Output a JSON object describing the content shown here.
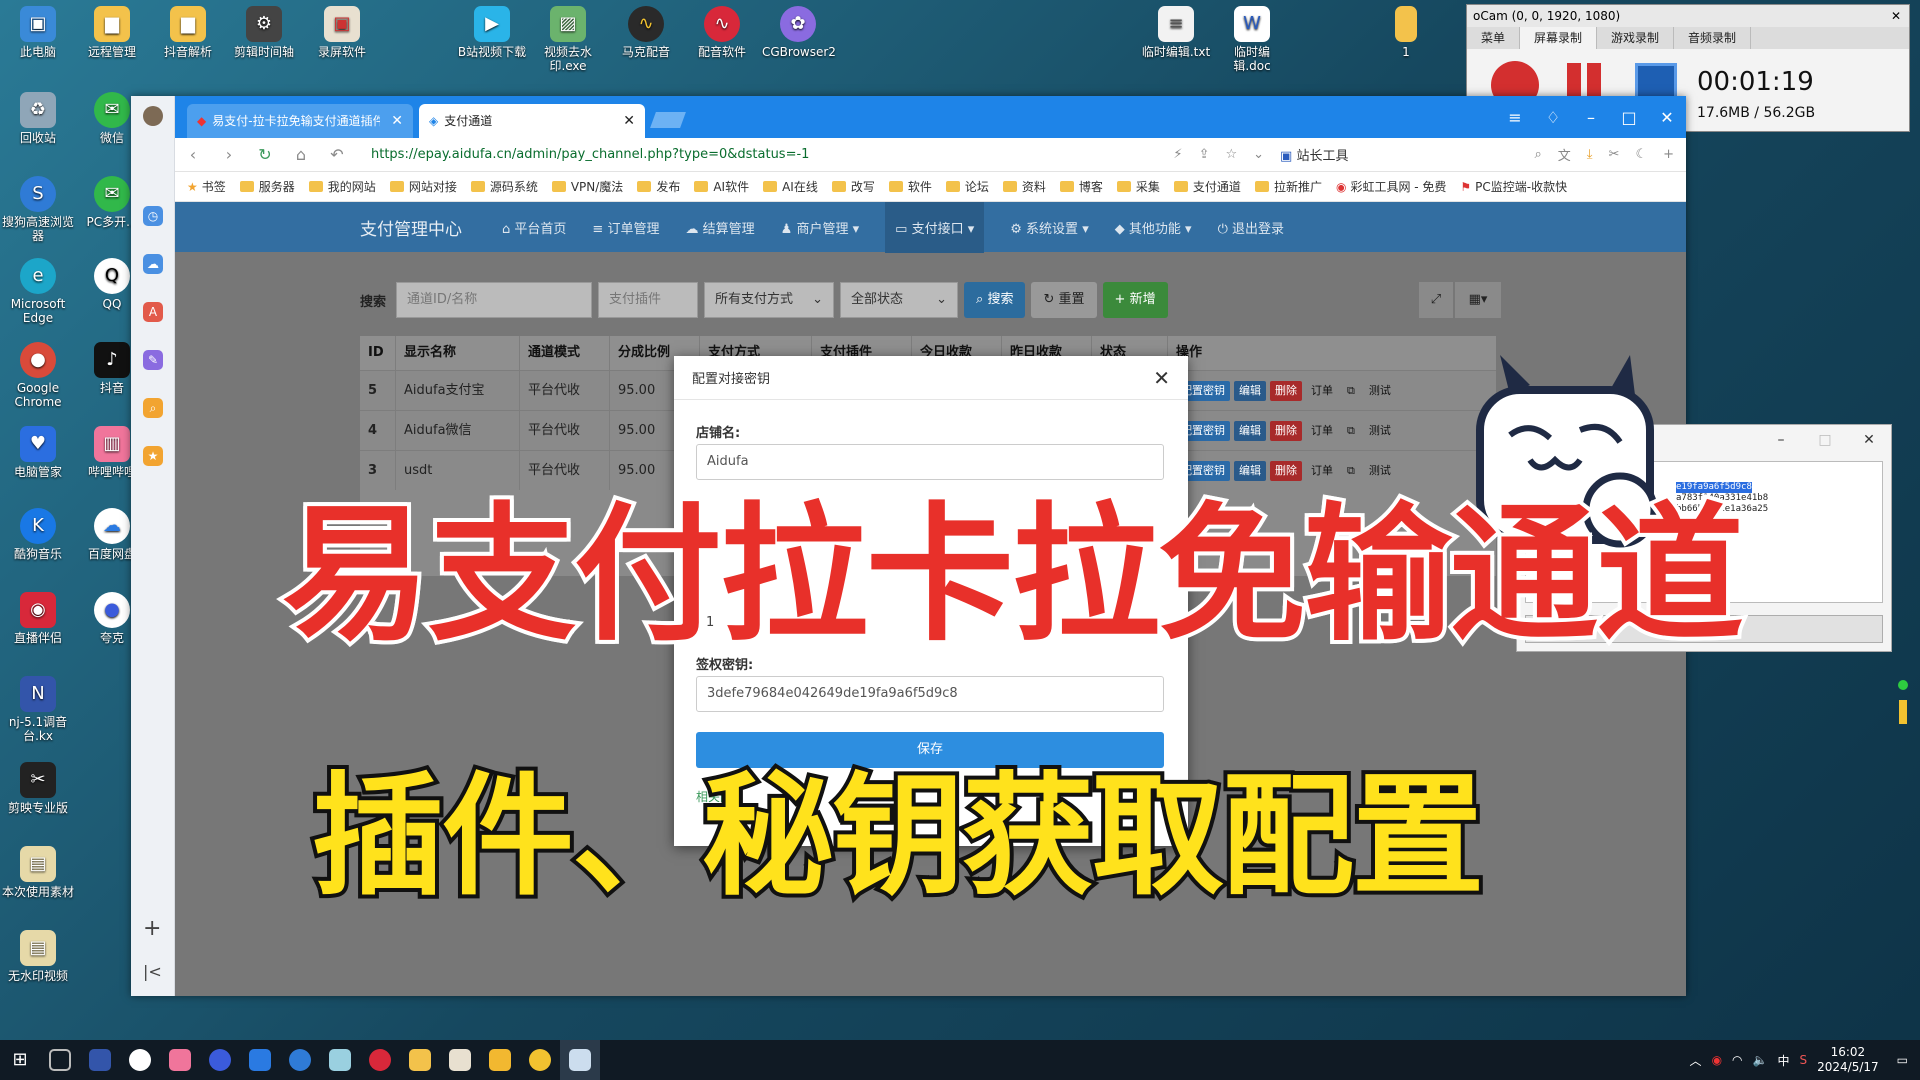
{
  "desktop": {
    "icons_col1": [
      "此电脑",
      "回收站",
      "搜狗高速浏览器",
      "Microsoft Edge",
      "Google Chrome",
      "电脑管家",
      "酷狗音乐",
      "直播伴侣",
      "nj-5.1调音台.kx",
      "剪映专业版",
      "本次使用素材",
      "无水印视频"
    ],
    "icons_col2": [
      "远程管理",
      "微信",
      "PC多开...",
      "QQ",
      "抖音",
      "哔哩哔哩",
      "百度网盘",
      "夸克"
    ],
    "icons_top": [
      "抖音解析",
      "剪辑时间轴",
      "录屏软件",
      "B站视频下载",
      "视频去水印.exe",
      "马克配音",
      "配音软件",
      "CGBrowser2",
      "临时编辑.txt",
      "临时编辑.doc",
      "1"
    ]
  },
  "ocam": {
    "title": "oCam (0, 0, 1920, 1080)",
    "tabs": [
      "菜单",
      "屏幕录制",
      "游戏录制",
      "音频录制"
    ],
    "time": "00:01:19",
    "size": "17.6MB / 56.2GB"
  },
  "browser": {
    "tabs": [
      {
        "label": "易支付-拉卡拉免输支付通道插件"
      },
      {
        "label": "支付通道"
      }
    ],
    "url": "https://epay.aidufa.cn/admin/pay_channel.php?type=0&dstatus=-1",
    "toolbox": "站长工具",
    "bookmarks": [
      "书签",
      "服务器",
      "我的网站",
      "网站对接",
      "源码系统",
      "VPN/魔法",
      "发布",
      "AI软件",
      "AI在线",
      "改写",
      "软件",
      "论坛",
      "资料",
      "博客",
      "采集",
      "支付通道",
      "拉新推广",
      "彩虹工具网 - 免费",
      "PC监控端-收款快"
    ]
  },
  "admin": {
    "brand": "支付管理中心",
    "nav": [
      "平台首页",
      "订单管理",
      "结算管理",
      "商户管理",
      "支付接口",
      "系统设置",
      "其他功能",
      "退出登录"
    ],
    "search_label": "搜索",
    "search_placeholder": "通道ID/名称",
    "plugin_placeholder": "支付插件",
    "method_select": "所有支付方式",
    "status_select": "全部状态",
    "btn_search": "搜索",
    "btn_reset": "重置",
    "btn_add": "新增",
    "columns": [
      "ID",
      "显示名称",
      "通道模式",
      "分成比例",
      "支付方式",
      "支付插件",
      "今日收款",
      "昨日收款",
      "状态",
      "操作"
    ],
    "rows": [
      {
        "id": "5",
        "name": "Aidufa支付宝",
        "mode": "平台代收",
        "rate": "95.00"
      },
      {
        "id": "4",
        "name": "Aidufa微信",
        "mode": "平台代收",
        "rate": "95.00"
      },
      {
        "id": "3",
        "name": "usdt",
        "mode": "平台代收",
        "rate": "95.00"
      }
    ],
    "actions": [
      "配置密钥",
      "编辑",
      "删除",
      "订单",
      "测试"
    ]
  },
  "modal": {
    "title": "配置对接密钥",
    "shop_label": "店铺名:",
    "shop_value": "Aidufa",
    "field2_value": "1",
    "key_label": "签权密钥:",
    "key_value": "3defe79684e042649de19fa9a6f5d9c8",
    "save": "保存",
    "link": "相关配"
  },
  "small_window": {
    "lines": [
      "e19fa9a6f5d9c8",
      "a783f140a331e41b8",
      "bb66b1f41e1a36a25"
    ],
    "button": "启动"
  },
  "captions": {
    "title": "易支付拉卡拉免输通道",
    "subtitle": "插件、秘钥获取配置"
  },
  "taskbar": {
    "time": "16:02",
    "date": "2024/5/17",
    "ime": "中"
  },
  "colors": {
    "accent": "#1e84e8",
    "nav": "#336ea1",
    "caption_red": "#e8302a",
    "caption_yellow": "#ffe21c"
  }
}
